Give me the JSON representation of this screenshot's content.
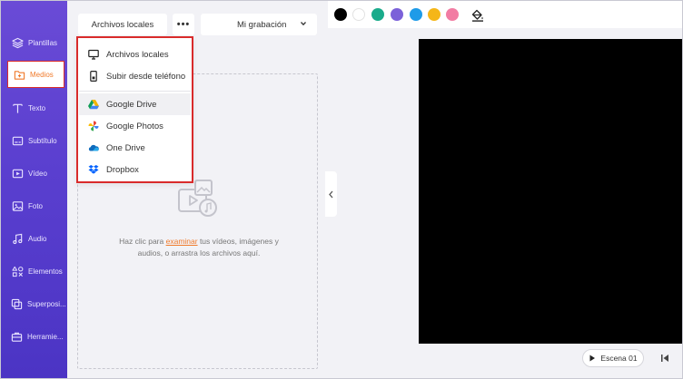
{
  "sidebar": {
    "items": [
      {
        "label": "Plantillas",
        "icon": "layers-icon"
      },
      {
        "label": "Medios",
        "icon": "media-folder-icon",
        "active": true
      },
      {
        "label": "Texto",
        "icon": "text-icon"
      },
      {
        "label": "Subtítulo",
        "icon": "subtitle-icon"
      },
      {
        "label": "Vídeo",
        "icon": "video-icon"
      },
      {
        "label": "Foto",
        "icon": "image-icon"
      },
      {
        "label": "Audio",
        "icon": "music-icon"
      },
      {
        "label": "Elementos",
        "icon": "elements-icon"
      },
      {
        "label": "Superposi...",
        "icon": "overlay-icon"
      },
      {
        "label": "Herramie...",
        "icon": "toolbox-icon"
      }
    ]
  },
  "media_panel": {
    "local_files_button": "Archivos locales",
    "more_button": "•••",
    "recording_select": "Mi grabación",
    "dropzone": {
      "text_before": "Haz clic para ",
      "link": "examinar",
      "text_after": " tus vídeos, imágenes y audios, o arrastra los archivos aquí."
    }
  },
  "dropdown": {
    "items": [
      {
        "label": "Archivos locales",
        "icon": "monitor-icon"
      },
      {
        "label": "Subir desde teléfono",
        "icon": "phone-icon"
      },
      {
        "label": "Google Drive",
        "icon": "google-drive-icon"
      },
      {
        "label": "Google Photos",
        "icon": "google-photos-icon"
      },
      {
        "label": "One Drive",
        "icon": "onedrive-icon"
      },
      {
        "label": "Dropbox",
        "icon": "dropbox-icon"
      }
    ]
  },
  "color_toolbar": {
    "swatches": [
      "#000000",
      "#ffffff",
      "#1aab8b",
      "#7b61d9",
      "#1e9be8",
      "#f5b618",
      "#f27ca3"
    ],
    "fill_tool_icon": "paint-bucket-icon"
  },
  "scene": {
    "label": "Escena 01"
  },
  "colors": {
    "accent": "#f07a2b",
    "sidebar": "#5a3fcf",
    "highlight": "#d92b2b"
  }
}
